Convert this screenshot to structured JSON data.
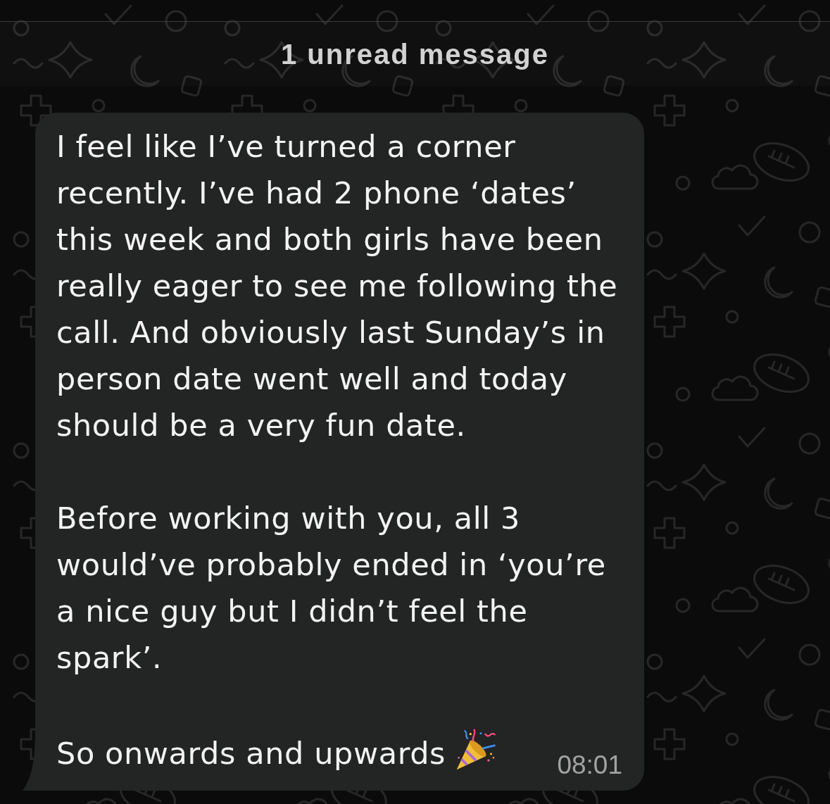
{
  "banner": {
    "text": "1 unread message"
  },
  "message": {
    "paragraphs": [
      "I feel like I’ve turned a corner recently. I’ve had 2 phone ‘dates’ this week and both girls have been really eager to see me following the call. And obviously last Sunday’s in person date went well and today should be a very fun date.",
      "Before working with you, all 3 would’ve probably ended in ‘you’re a nice guy but I didn’t feel the spark’.",
      "So onwards and upwards"
    ],
    "time": "08:01"
  }
}
